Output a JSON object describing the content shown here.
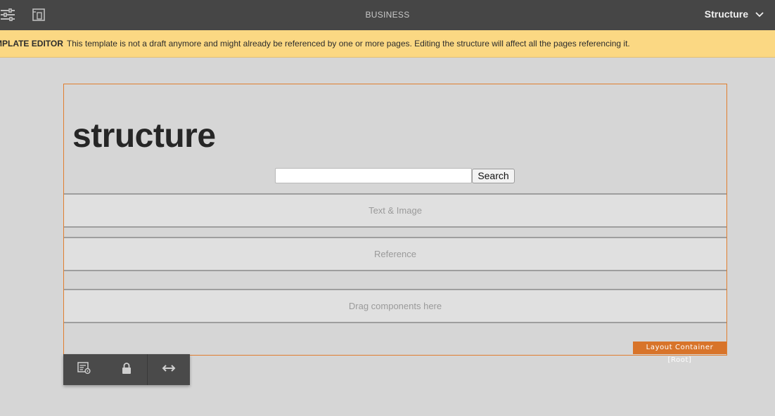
{
  "topbar": {
    "title": "BUSINESS",
    "mode_label": "Structure",
    "icons": [
      "side-panel-toggle-icon",
      "page-properties-icon",
      "chevron-down-icon"
    ]
  },
  "banner": {
    "label": "MPLATE EDITOR",
    "message": "This template is not a draft anymore and might already be referenced by one or more pages. Editing the structure will affect all the pages referencing it."
  },
  "page": {
    "title": "structure",
    "search": {
      "value": "",
      "button_label": "Search"
    },
    "components": [
      {
        "label": "Text & Image"
      },
      {
        "label": "Reference"
      },
      {
        "label": "Drag components here"
      }
    ],
    "container_tag": "Layout Container [Root]"
  },
  "component_toolbar": {
    "icons": [
      "policy-icon",
      "lock-icon",
      "resize-icon"
    ]
  },
  "colors": {
    "toolbar_bg": "#464646",
    "banner_bg": "#fbd883",
    "accent_orange": "#e07e2f",
    "canvas_bg": "#d6d6d6"
  }
}
